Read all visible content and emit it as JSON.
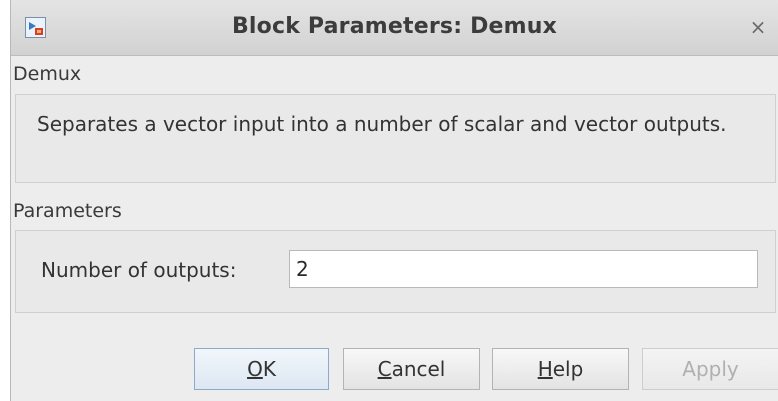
{
  "window": {
    "title": "Block Parameters: Demux",
    "close_glyph": "×",
    "icon": "simulink-block-icon"
  },
  "block_group": {
    "label": "Demux",
    "description": "Separates a vector input into a number of scalar and vector outputs."
  },
  "parameters_group": {
    "label": "Parameters",
    "number_of_outputs": {
      "label": "Number of outputs:",
      "value": "2"
    }
  },
  "buttons": {
    "ok": {
      "mnemonic": "O",
      "rest": "K"
    },
    "cancel": {
      "mnemonic": "C",
      "rest": "ancel"
    },
    "help": {
      "mnemonic": "H",
      "rest": "elp"
    },
    "apply": {
      "label": "Apply",
      "enabled": false
    }
  },
  "colors": {
    "dialog_background": "#ededed",
    "ok_border_accent": "#8eaacb",
    "disabled_text": "#b0b0b0"
  }
}
